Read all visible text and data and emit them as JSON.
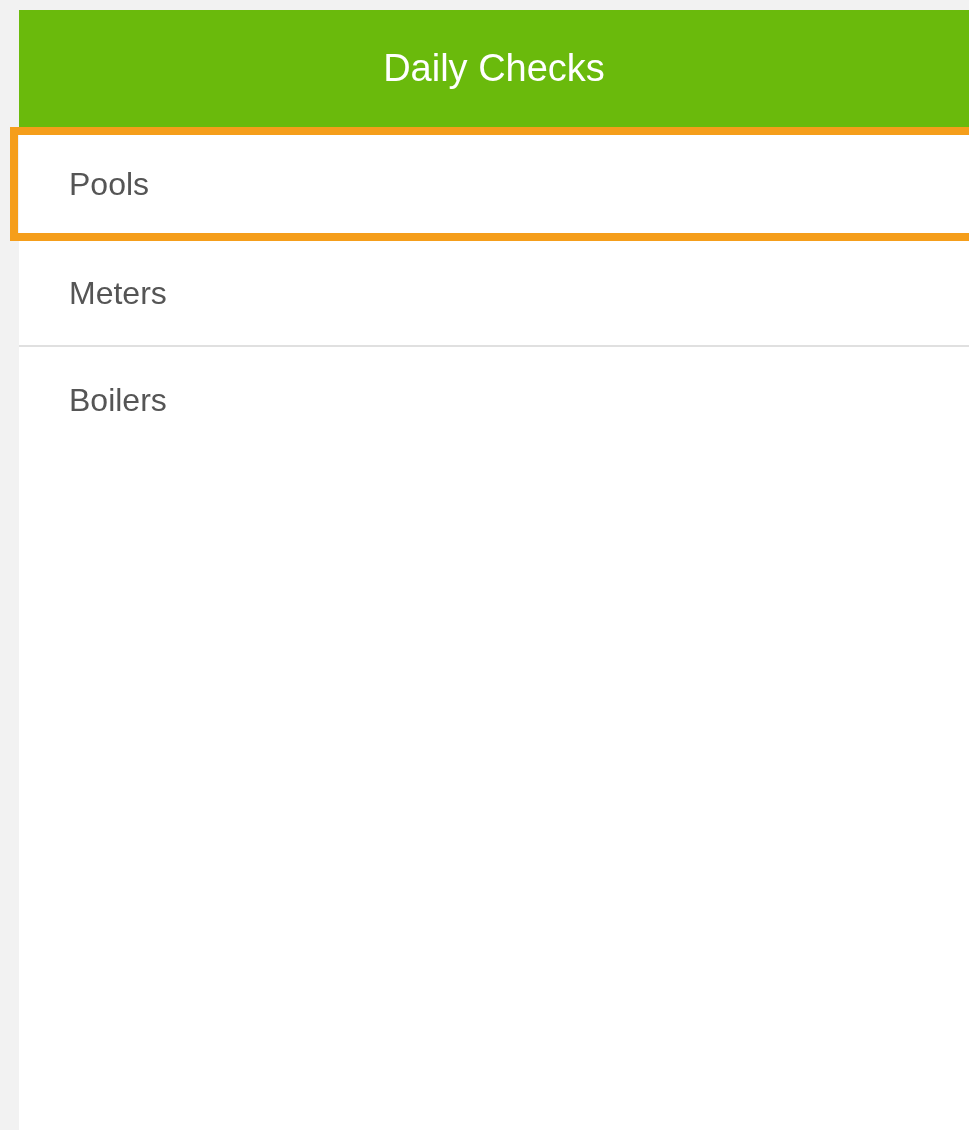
{
  "header": {
    "title": "Daily Checks"
  },
  "items": [
    {
      "label": "Pools",
      "selected": true
    },
    {
      "label": "Meters",
      "selected": false
    },
    {
      "label": "Boilers",
      "selected": false
    }
  ]
}
